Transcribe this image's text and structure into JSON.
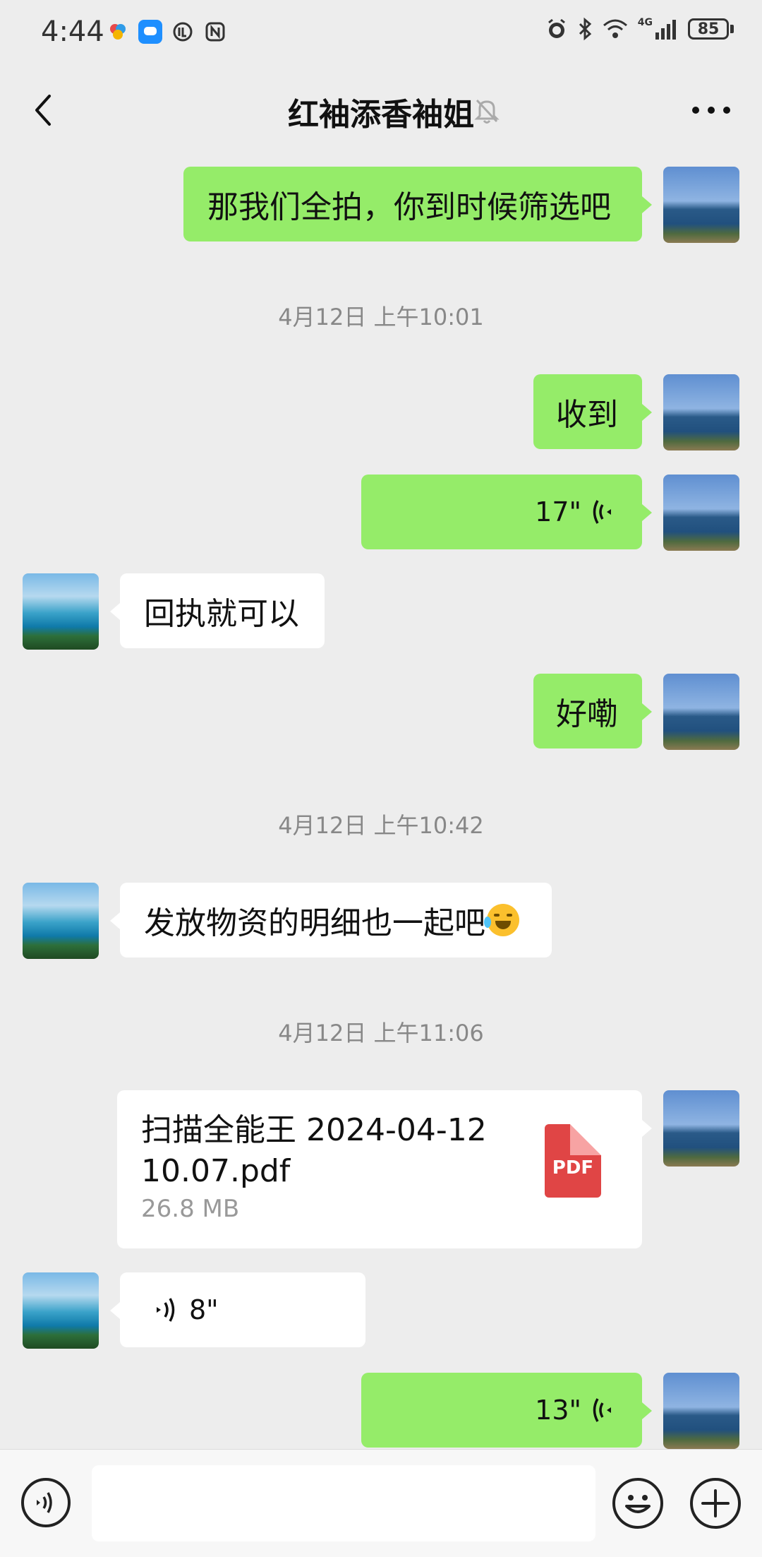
{
  "status_bar": {
    "time": "4:44",
    "battery": "85",
    "network": "4G"
  },
  "header": {
    "title": "红袖添香袖姐"
  },
  "messages": [
    {
      "side": "me",
      "type": "text",
      "text": "那我们全拍，你到时候筛选吧"
    },
    {
      "type": "timestamp",
      "text": "4月12日 上午10:01"
    },
    {
      "side": "me",
      "type": "text",
      "text": "收到"
    },
    {
      "side": "me",
      "type": "voice",
      "duration": "17\""
    },
    {
      "side": "other",
      "type": "text",
      "text": "回执就可以"
    },
    {
      "side": "me",
      "type": "text",
      "text": "好嘞"
    },
    {
      "type": "timestamp",
      "text": "4月12日 上午10:42"
    },
    {
      "side": "other",
      "type": "text",
      "text": "发放物资的明细也一起吧"
    },
    {
      "type": "timestamp",
      "text": "4月12日 上午11:06"
    },
    {
      "side": "me",
      "type": "file",
      "name_line1": "扫描全能王 2024-04-12",
      "name_line2": "10.07.pdf",
      "size": "26.8 MB",
      "file_type": "PDF"
    },
    {
      "side": "other",
      "type": "voice",
      "duration": "8\""
    },
    {
      "side": "me",
      "type": "voice",
      "duration": "13\""
    }
  ],
  "colors": {
    "my_bubble": "#95ec69",
    "other_bubble": "#ffffff",
    "background": "#ededed"
  }
}
